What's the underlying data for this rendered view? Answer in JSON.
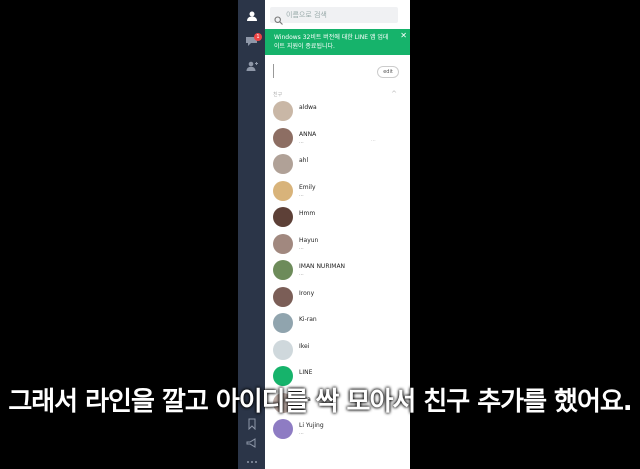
{
  "rail": {
    "icons": [
      "person-icon",
      "chat-icon",
      "add-friend-icon",
      "bookmark-icon",
      "megaphone-icon",
      "more-icon"
    ],
    "chat_badge": "1"
  },
  "search": {
    "placeholder": "이름으로 검색"
  },
  "notice": {
    "text": "Windows 32비트 버전에 대한 LINE 앱 업데이트 지원이 종료됩니다.",
    "close": "✕"
  },
  "profile": {
    "edit_label": "edit"
  },
  "friends_section": {
    "label": "친구",
    "chevron": "^"
  },
  "friends": [
    {
      "name": "aldwa",
      "status": "",
      "color": "#c9b7a6"
    },
    {
      "name": "ANNA",
      "status": "...",
      "extra": "...",
      "color": "#8d6e63"
    },
    {
      "name": "ahl",
      "status": "",
      "color": "#b0a197"
    },
    {
      "name": "Emily",
      "status": "...",
      "color": "#d8b37a"
    },
    {
      "name": "Hmm",
      "status": "",
      "color": "#5d4037"
    },
    {
      "name": "Hayun",
      "status": "...",
      "color": "#a1887f"
    },
    {
      "name": "IMAN NURIMAN",
      "status": "...",
      "color": "#6d8b5a"
    },
    {
      "name": "Irony",
      "status": "",
      "color": "#7b5e57"
    },
    {
      "name": "Ki-ran",
      "status": "",
      "color": "#90a4ae"
    },
    {
      "name": "Ikei",
      "status": "",
      "color": "#cfd8dc"
    },
    {
      "name": "LINE",
      "status": "",
      "color": "#16b36b"
    },
    {
      "name": "Lisa",
      "status": "",
      "color": "#bcaaa4"
    },
    {
      "name": "Li Yujing",
      "status": "...",
      "color": "#8e7cc3"
    }
  ],
  "caption": "그래서 라인을 깔고 아이디를 싹 모아서 친구 추가를 했어요."
}
